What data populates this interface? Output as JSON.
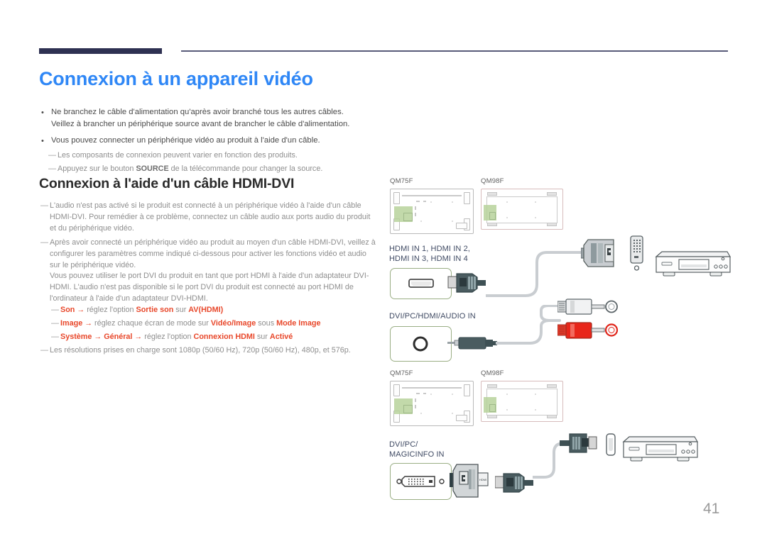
{
  "document": {
    "page_number": "41",
    "title": "Connexion à un appareil vidéo",
    "section_title": "Connexion à l'aide d'un câble HDMI-DVI"
  },
  "bullets": [
    {
      "line1": "Ne branchez le câble d'alimentation qu'après avoir branché tous les autres câbles.",
      "line2": "Veillez à brancher un périphérique source avant de brancher le câble d'alimentation."
    },
    {
      "line1": "Vous pouvez connecter un périphérique vidéo au produit à l'aide d'un câble.",
      "line2": ""
    }
  ],
  "intro_notes": [
    "Les composants de connexion peuvent varier en fonction des produits.",
    "Appuyez sur le bouton SOURCE de la télécommande pour changer la source."
  ],
  "intro_notes_bold": [
    "",
    "SOURCE"
  ],
  "section_notes": {
    "note1": "L'audio n'est pas activé si le produit est connecté à un périphérique vidéo à l'aide d'un câble HDMI-DVI. Pour remédier à ce problème, connectez un câble audio aux ports audio du produit et du périphérique vidéo.",
    "note2": "Après avoir connecté un périphérique vidéo au produit au moyen d'un câble HDMI-DVI, veillez à configurer les paramètres comme indiqué ci-dessous pour activer les fonctions vidéo et audio sur le périphérique vidéo.",
    "note2_para2": "Vous pouvez utiliser le port DVI du produit en tant que port HDMI à l'aide d'un adaptateur DVI-HDMI. L'audio n'est pas disponible si le port DVI du produit est connecté au port HDMI de l'ordinateur à l'aide d'un adaptateur DVI-HDMI.",
    "note3": "Les résolutions prises en charge sont 1080p (50/60 Hz), 720p (50/60 Hz), 480p, et 576p."
  },
  "settings_paths": [
    {
      "menu": "Son",
      "arrow1": "→",
      "mid": "réglez l'option",
      "option": "Sortie son",
      "sur": "sur",
      "value": "AV(HDMI)"
    },
    {
      "menu": "Image",
      "arrow1": "→",
      "mid": "réglez chaque écran de mode sur",
      "option": "Vidéo/Image",
      "sur": "sous",
      "value": "Mode Image"
    },
    {
      "menu": "Système",
      "arrow1": "→",
      "sub": "Général",
      "arrow2": "→",
      "mid": "réglez l'option",
      "option": "Connexion HDMI",
      "sur": "sur",
      "value": "Activé"
    }
  ],
  "diagram_top": {
    "model_left": "QM75F",
    "model_right": "QM98F",
    "hdmi_port_label_line1": "HDMI IN 1, HDMI IN 2,",
    "hdmi_port_label_line2": "HDMI IN 3, HDMI IN 4",
    "audio_port_label": "DVI/PC/HDMI/AUDIO IN",
    "icons": {
      "hdmi_jack": "hdmi-port-icon",
      "audio_jack": "audio-jack-port-icon",
      "dvi_connector": "dvi-connector-icon",
      "rca_white": "rca-white-connector-icon",
      "rca_red": "rca-red-connector-icon",
      "video_device": "video-device-icon"
    }
  },
  "diagram_bottom": {
    "model_left": "QM75F",
    "model_right": "QM98F",
    "dvi_port_label_line1": "DVI/PC/",
    "dvi_port_label_line2": "MAGICINFO IN",
    "icons": {
      "dvi_port": "dvi-port-icon",
      "dvi_to_hdmi_cable": "dvi-hdmi-cable-icon",
      "hdmi_connector": "hdmi-connector-icon",
      "video_device": "video-device-icon"
    }
  },
  "colors": {
    "title_blue": "#2f87f6",
    "header_navy": "#2e3152",
    "accent_red": "#e8472a",
    "port_green": "#9aae84",
    "panel_green": "#b7d29b",
    "note_gray": "#8e8e8e"
  }
}
